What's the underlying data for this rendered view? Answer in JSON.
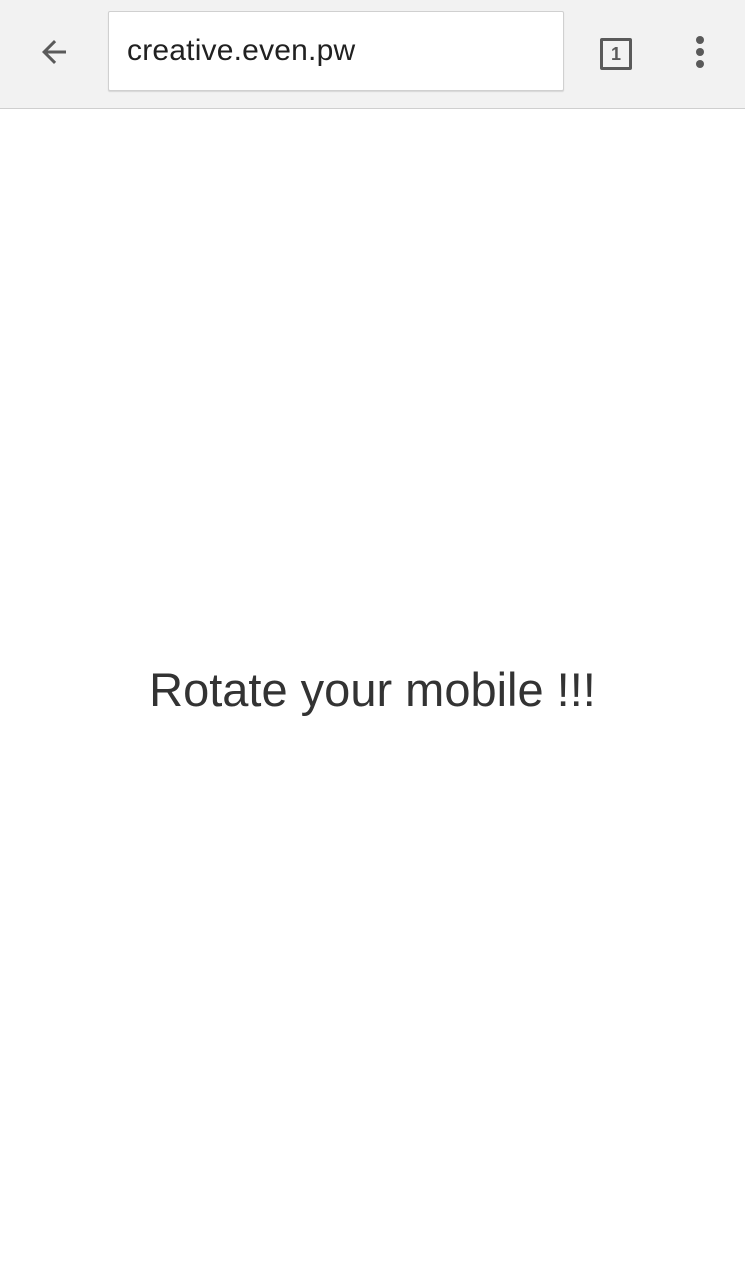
{
  "browser": {
    "url": "creative.even.pw",
    "tab_count": "1",
    "icons": {
      "back": "arrow-back-icon",
      "tabs": "tab-switcher-icon",
      "menu": "overflow-menu-icon"
    }
  },
  "page": {
    "message": "Rotate your mobile !!!"
  },
  "colors": {
    "toolbar_bg": "#f2f2f2",
    "icon": "#5a5a5a",
    "text": "#333333"
  }
}
